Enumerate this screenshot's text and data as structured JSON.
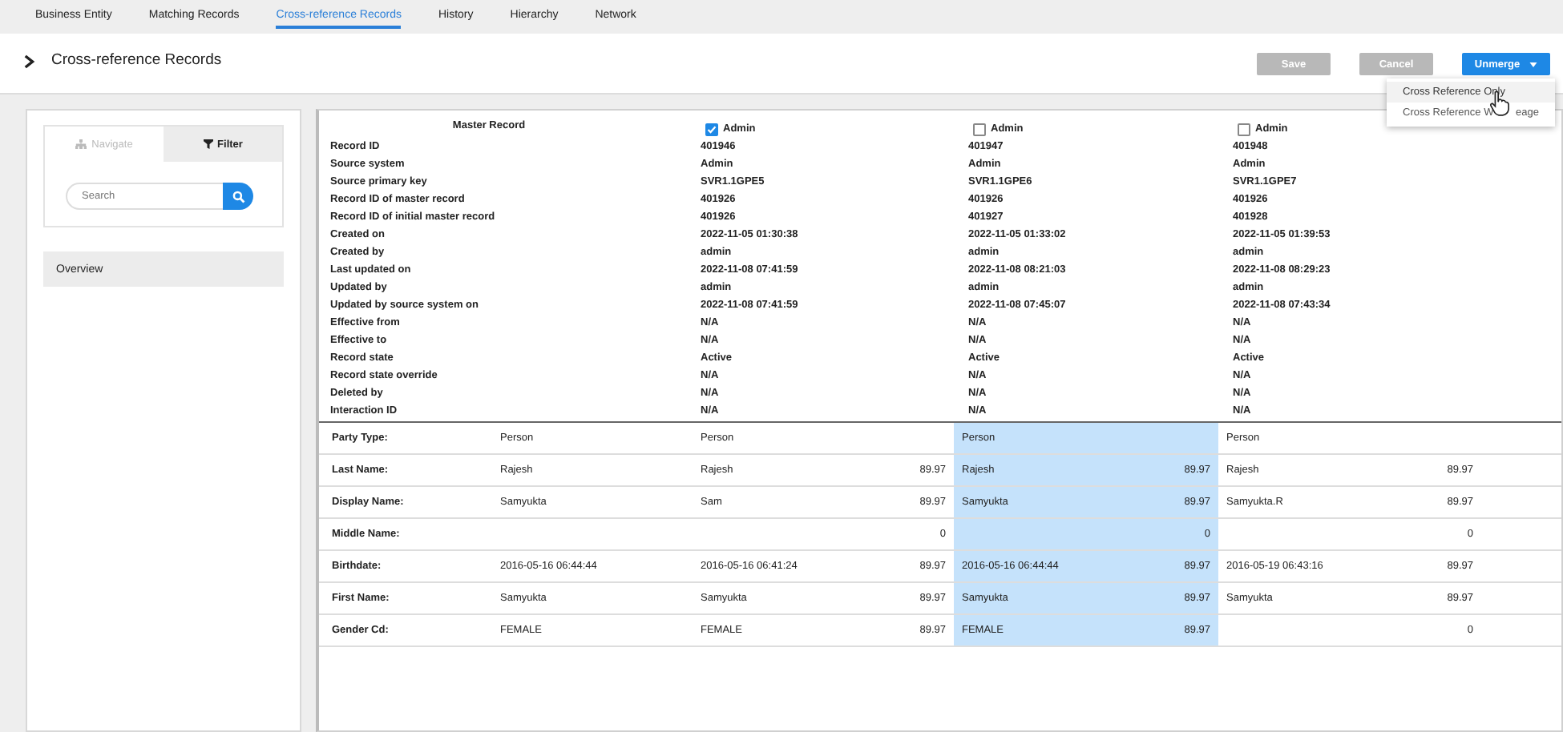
{
  "tabs": [
    {
      "label": "Business Entity",
      "selected": false
    },
    {
      "label": "Matching Records",
      "selected": false
    },
    {
      "label": "Cross-reference Records",
      "selected": true
    },
    {
      "label": "History",
      "selected": false
    },
    {
      "label": "Hierarchy",
      "selected": false
    },
    {
      "label": "Network",
      "selected": false
    }
  ],
  "page_title": "Cross-reference Records",
  "buttons": [
    {
      "label": "Save",
      "disabled": true
    },
    {
      "label": "Cancel",
      "disabled": true
    },
    {
      "label": "Unmerge",
      "disabled": false
    }
  ],
  "unmerge_menu": {
    "items": [
      {
        "label": "Cross Reference Only",
        "selected": true
      },
      {
        "label": "Cross Reference W",
        "selected": false,
        "label_end": "eage"
      }
    ]
  },
  "side_panel": {
    "tabs": [
      {
        "label": "Navigate",
        "selected": false
      },
      {
        "label": "Filter",
        "selected": true
      }
    ],
    "search": {
      "placeholder": "Search"
    },
    "items": [
      {
        "label": "Overview"
      }
    ]
  },
  "record_header": {
    "title": "Master Record",
    "fields": [
      "Record ID",
      "Source system",
      "Source primary key",
      "Record ID of master record",
      "Record ID of initial master record",
      "Created on",
      "Created by",
      "Last updated on",
      "Updated by",
      "Updated by source system on",
      "Effective from",
      "Effective to",
      "Record state",
      "Record state override",
      "Deleted by",
      "Interaction ID"
    ]
  },
  "records": [
    {
      "source": "Admin",
      "checked": true,
      "highlighted": false,
      "values": [
        "401946",
        "Admin",
        "SVR1.1GPE5",
        "401926",
        "401926",
        "2022-11-05 01:30:38",
        "admin",
        "2022-11-08 07:41:59",
        "admin",
        "2022-11-08 07:41:59",
        "N/A",
        "N/A",
        "Active",
        "N/A",
        "N/A",
        "N/A"
      ]
    },
    {
      "source": "Admin",
      "checked": false,
      "highlighted": true,
      "values": [
        "401947",
        "Admin",
        "SVR1.1GPE6",
        "401926",
        "401927",
        "2022-11-05 01:33:02",
        "admin",
        "2022-11-08 08:21:03",
        "admin",
        "2022-11-08 07:45:07",
        "N/A",
        "N/A",
        "Active",
        "N/A",
        "N/A",
        "N/A"
      ]
    },
    {
      "source": "Admin",
      "checked": false,
      "highlighted": false,
      "values": [
        "401948",
        "Admin",
        "SVR1.1GPE7",
        "401926",
        "401928",
        "2022-11-05 01:39:53",
        "admin",
        "2022-11-08 08:29:23",
        "admin",
        "2022-11-08 07:43:34",
        "N/A",
        "N/A",
        "Active",
        "N/A",
        "N/A",
        "N/A"
      ]
    }
  ],
  "attributes": [
    {
      "label": "Party Type:",
      "master": "Person",
      "cells": [
        {
          "value": "Person"
        },
        {
          "value": "Person"
        },
        {
          "value": "Person"
        }
      ]
    },
    {
      "label": "Last Name:",
      "master": "Rajesh",
      "cells": [
        {
          "value": "Rajesh",
          "score": "89.97"
        },
        {
          "value": "Rajesh",
          "score": "89.97"
        },
        {
          "value": "Rajesh",
          "score": "89.97"
        }
      ]
    },
    {
      "label": "Display Name:",
      "master": "Samyukta",
      "cells": [
        {
          "value": "Sam",
          "score": "89.97"
        },
        {
          "value": "Samyukta",
          "score": "89.97"
        },
        {
          "value": "Samyukta.R",
          "score": "89.97"
        }
      ]
    },
    {
      "label": "Middle Name:",
      "cells": [
        {
          "score": "0"
        },
        {
          "score": "0"
        },
        {
          "score": "0"
        }
      ]
    },
    {
      "label": "Birthdate:",
      "master": "2016-05-16 06:44:44",
      "cells": [
        {
          "value": "2016-05-16 06:41:24",
          "score": "89.97"
        },
        {
          "value": "2016-05-16 06:44:44",
          "score": "89.97"
        },
        {
          "value": "2016-05-19 06:43:16",
          "score": "89.97"
        }
      ]
    },
    {
      "label": "First Name:",
      "master": "Samyukta",
      "cells": [
        {
          "value": "Samyukta",
          "score": "89.97"
        },
        {
          "value": "Samyukta",
          "score": "89.97"
        },
        {
          "value": "Samyukta",
          "score": "89.97"
        }
      ]
    },
    {
      "label": "Gender Cd:",
      "master": "FEMALE",
      "cells": [
        {
          "value": "FEMALE",
          "score": "89.97"
        },
        {
          "value": "FEMALE",
          "score": "89.97"
        },
        {
          "score": "0"
        }
      ]
    }
  ]
}
